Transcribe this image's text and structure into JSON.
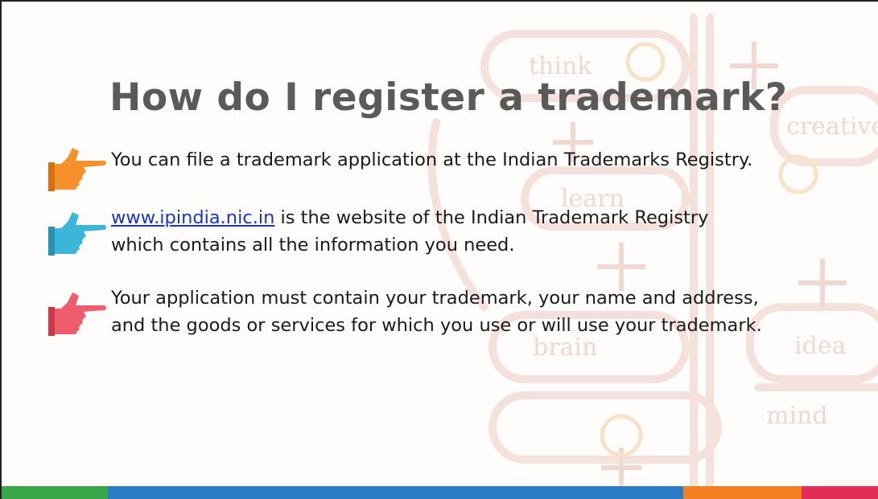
{
  "slide": {
    "title": "How do I register a trademark?",
    "bullets": [
      {
        "icon": "hand-pointing-icon",
        "color": "#f5902a",
        "lines": [
          "You can file a trademark application at the Indian Trademarks Registry."
        ]
      },
      {
        "icon": "hand-pointing-icon",
        "color": "#3bb5d8",
        "link": "www.ipindia.nic.in",
        "line1_rest": " is the website of the Indian Trademark Registry",
        "line2": "which contains all the information you need."
      },
      {
        "icon": "hand-pointing-icon",
        "color": "#ee5c6e",
        "lines": [
          "Your application must contain your trademark, your name and address,",
          "and the goods or services for which you use or will use your trademark."
        ]
      }
    ],
    "background_words": [
      "think",
      "creative",
      "learn",
      "brain",
      "idea",
      "mind"
    ],
    "footer_colors": [
      "#3aa64a",
      "#2a7dc4",
      "#f27f21",
      "#e02e55"
    ]
  }
}
